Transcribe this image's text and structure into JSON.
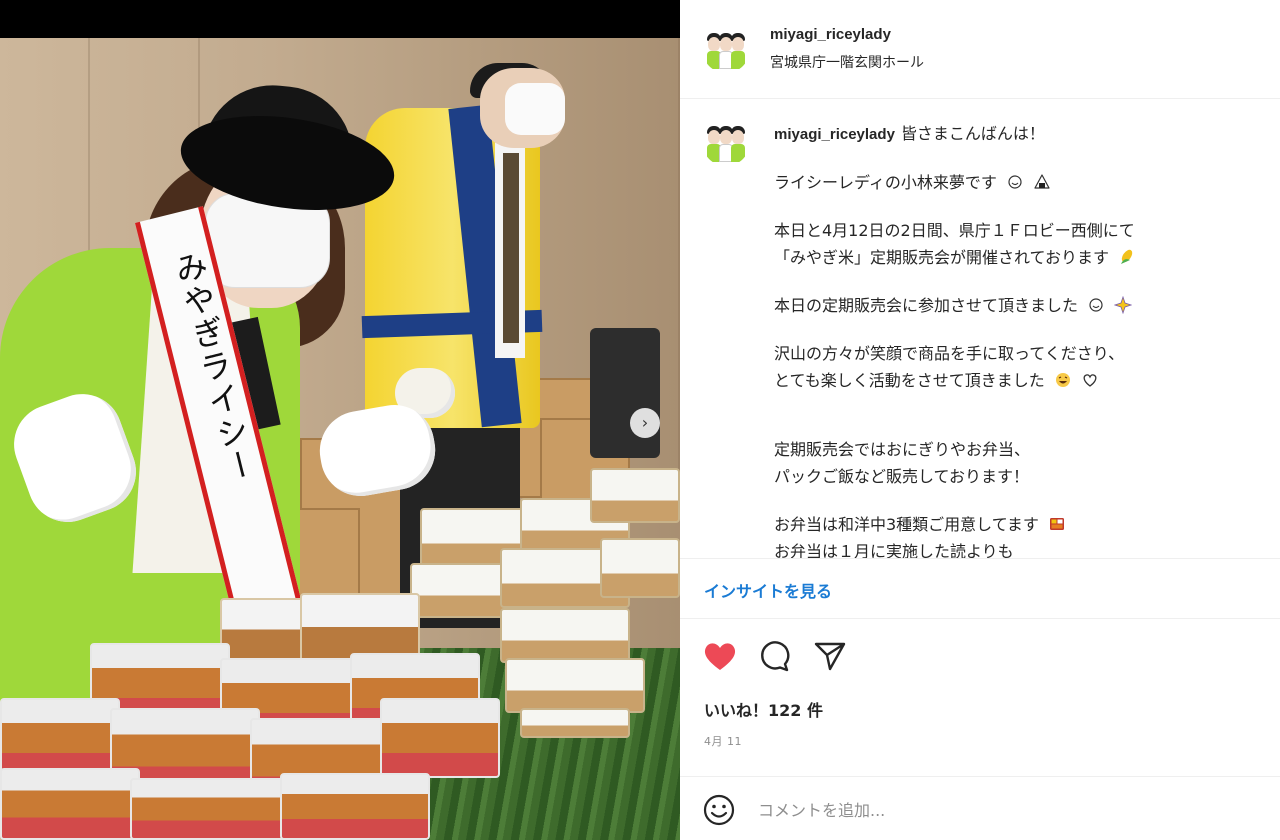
{
  "post": {
    "username": "miyagi_riceylady",
    "location": "宮城県庁一階玄関ホール"
  },
  "photo": {
    "sash_text": "みやぎライシー"
  },
  "caption": {
    "username": "miyagi_riceylady",
    "lines": [
      "皆さまこんばんは！",
      "ライシーレディの小林来夢です",
      "本日と4月12日の2日間、県庁１Ｆロビー西側にて",
      "「みやぎ米」定期販売会が開催されております",
      "本日の定期販売会に参加させて頂きました",
      "沢山の方々が笑顔で商品を手に取ってくださり、",
      "とても楽しく活動をさせて頂きました",
      "定期販売会ではおにぎりやお弁当、",
      "パックご飯など販売しております！",
      "お弁当は和洋中3種類ご用意してます",
      "お弁当は１月に実施した読よりも"
    ]
  },
  "insights_link": "インサイトを見る",
  "actions": {
    "like_icon": "heart-filled-icon",
    "comment_icon": "comment-bubble-icon",
    "share_icon": "paper-plane-icon",
    "like_color": "#ed4956"
  },
  "likes_text": "いいね！122 件",
  "date_text": "4月 11",
  "comment": {
    "emoji_icon": "smiley-icon",
    "placeholder": "コメントを追加..."
  },
  "colors": {
    "link": "#1a7bd4",
    "text": "#262626",
    "muted": "#8e8e8e"
  }
}
